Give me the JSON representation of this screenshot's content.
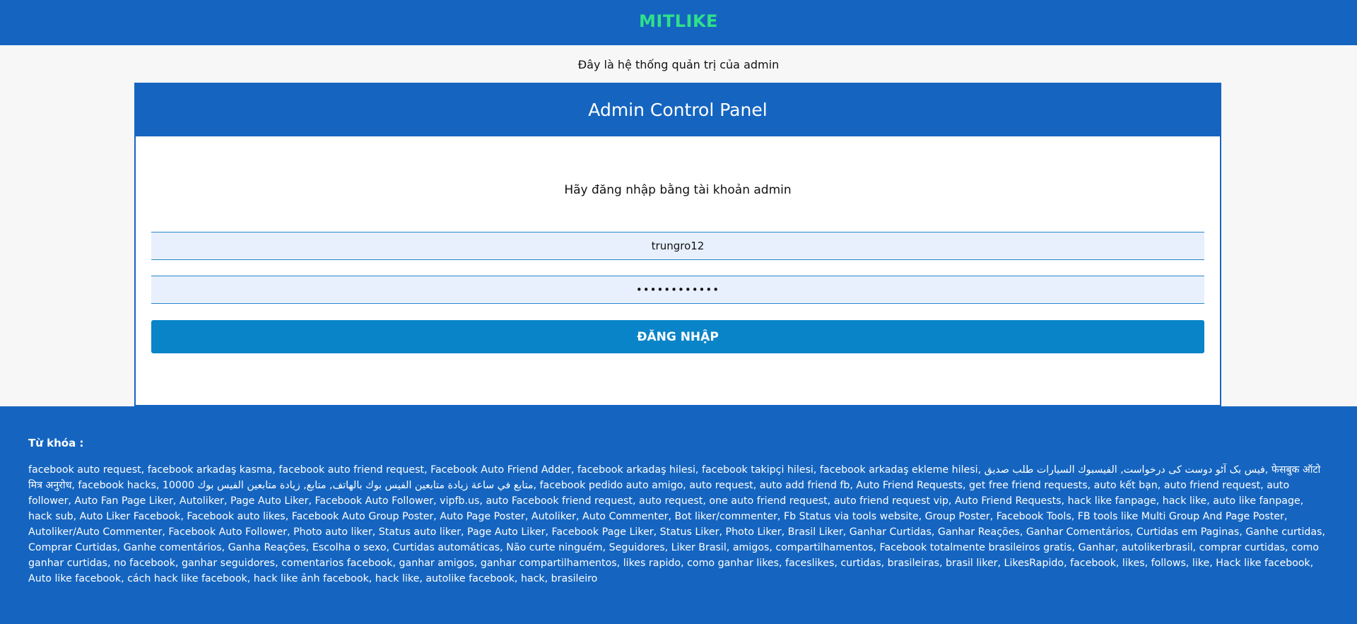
{
  "header": {
    "brand": "MITLIKE"
  },
  "subtitle": "Đây là hệ thống quản trị của admin",
  "panel": {
    "title": "Admin Control Panel",
    "prompt": "Hãy đăng nhập bằng tài khoản admin",
    "username_value": "trungro12",
    "password_value": "************",
    "login_label": "ĐĂNG NHẬP"
  },
  "footer": {
    "keywords_title": "Từ khóa :",
    "keywords": "facebook auto request, facebook arkadaş kasma, facebook auto friend request, Facebook Auto Friend Adder, facebook arkadaş hilesi, facebook takipçi hilesi, facebook arkadaş ekleme hilesi, فیس بک آٹو دوست کی درخواست, الفيسبوك السيارات طلب صديق, फेसबुक ऑटो मित्र अनुरोध, facebook hacks, 10000 متابع في ساعة زيادة متابعين الفيس بوك بالهاتف, متابع, زيادة متابعين الفيس بوك, facebook pedido auto amigo, auto request, auto add friend fb, Auto Friend Requests, get free friend requests, auto kết bạn, auto friend request, auto follower, Auto Fan Page Liker, Autoliker, Page Auto Liker, Facebook Auto Follower, vipfb.us, auto Facebook friend request, auto request, one auto friend request, auto friend request vip, Auto Friend Requests, hack like fanpage, hack like, auto like fanpage, hack sub, Auto Liker Facebook, Facebook auto likes, Facebook Auto Group Poster, Auto Page Poster, Autoliker, Auto Commenter, Bot liker/commenter, Fb Status via tools website, Group Poster, Facebook Tools, FB tools like Multi Group And Page Poster, Autoliker/Auto Commenter, Facebook Auto Follower, Photo auto liker, Status auto liker, Page Auto Liker, Facebook Page Liker, Status Liker, Photo Liker, Brasil Liker, Ganhar Curtidas, Ganhar Reações, Ganhar Comentários, Curtidas em Paginas, Ganhe curtidas, Comprar Curtidas, Ganhe comentários, Ganha Reações, Escolha o sexo, Curtidas automáticas, Não curte ninguém, Seguidores, Liker Brasil, amigos, compartilhamentos, Facebook totalmente brasileiros gratis, Ganhar, autolikerbrasil, comprar curtidas, como ganhar curtidas, no facebook, ganhar seguidores, comentarios facebook, ganhar amigos, ganhar compartilhamentos, likes rapido, como ganhar likes, faceslikes, curtidas, brasileiras, brasil liker, LikesRapido, facebook, likes, follows, like, Hack like facebook, Auto like facebook, cách hack like facebook, hack like ảnh facebook, hack like, autolike facebook, hack, brasileiro"
  },
  "colors": {
    "primary": "#1565c0",
    "brand": "#2ee08a",
    "button": "#0984c8",
    "input_bg": "#e8f0fe"
  }
}
